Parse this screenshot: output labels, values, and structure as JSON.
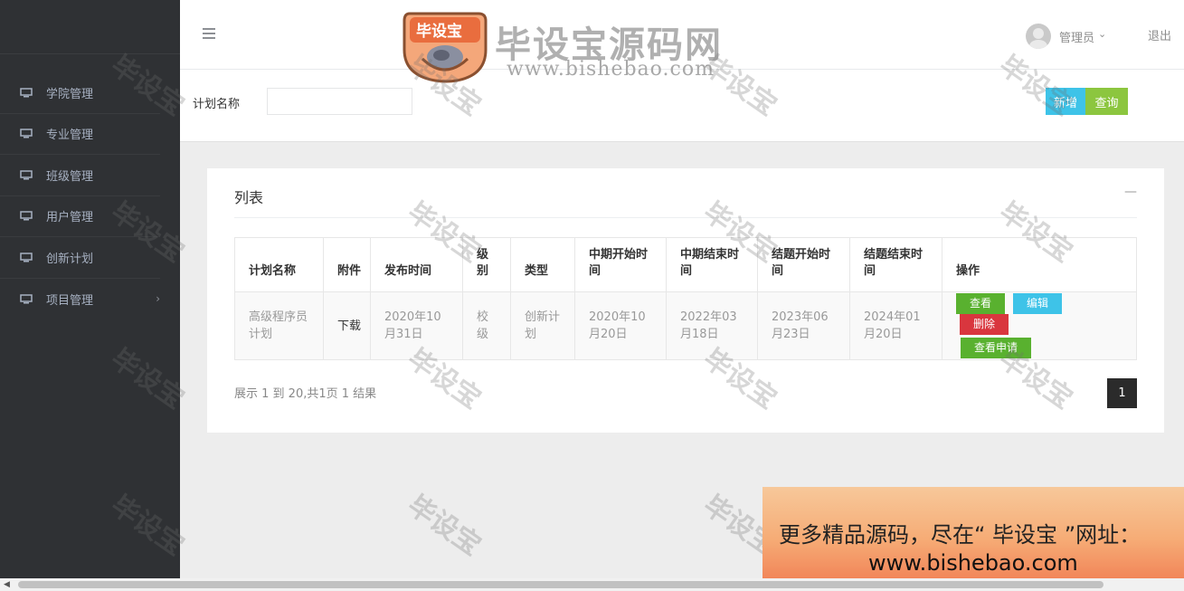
{
  "watermark": {
    "badge_text": "毕设宝",
    "site_title": "毕设宝源码网",
    "site_url": "www.bishebao.com",
    "tile_text": "毕设宝"
  },
  "sidebar": {
    "items": [
      {
        "label": "学院管理",
        "icon": "monitor-icon"
      },
      {
        "label": "专业管理",
        "icon": "monitor-icon"
      },
      {
        "label": "班级管理",
        "icon": "monitor-icon"
      },
      {
        "label": "用户管理",
        "icon": "monitor-icon"
      },
      {
        "label": "创新计划",
        "icon": "monitor-icon"
      },
      {
        "label": "项目管理",
        "icon": "monitor-icon",
        "has_children": true
      }
    ]
  },
  "header": {
    "user_name": "管理员",
    "logout_label": "退出"
  },
  "search": {
    "label": "计划名称",
    "value": "",
    "add_label": "新增",
    "query_label": "查询"
  },
  "panel": {
    "title": "列表",
    "collapse_symbol": "—",
    "columns": [
      "计划名称",
      "附件",
      "发布时间",
      "级别",
      "类型",
      "中期开始时间",
      "中期结束时间",
      "结题开始时间",
      "结题结束时间",
      "操作"
    ],
    "rows": [
      {
        "name": "高级程序员计划",
        "attachment": "下载",
        "publish_time": "2020年10月31日",
        "level": "校级",
        "type": "创新计划",
        "mid_start": "2020年10月20日",
        "mid_end": "2022年03月18日",
        "final_start": "2023年06月23日",
        "final_end": "2024年01月20日",
        "actions": {
          "view": "查看",
          "edit": "编辑",
          "delete": "删除",
          "view_apply": "查看申请"
        }
      }
    ],
    "pager_info": "展示 1 到 20,共1页 1 结果",
    "current_page": "1"
  },
  "promo": {
    "line1": "更多精品源码，尽在“ 毕设宝 ”网址：",
    "line2": "www.bishebao.com"
  },
  "colors": {
    "sidebar_bg": "#2f3134",
    "btn_info": "#3ec3e8",
    "btn_success": "#8cc63f",
    "btn_view": "#59b12f",
    "btn_danger": "#d9363e"
  }
}
